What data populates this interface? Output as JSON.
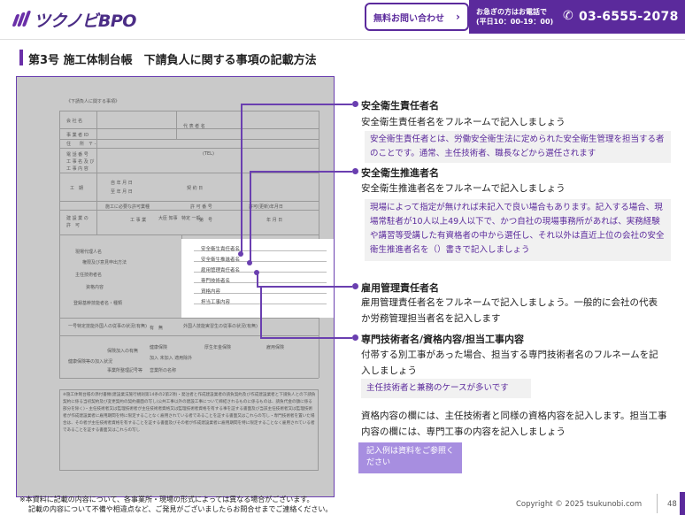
{
  "header": {
    "logo_text": "ツクノビBPO",
    "contact_button": "無料お問い合わせ",
    "phone_note_line1": "お急ぎの方はお電話で",
    "phone_note_line2": "(平日10：00-19：00)",
    "phone_number": "03-6555-2078"
  },
  "page_title": "第3号 施工体制台帳　下請負人に関する事項の記載方法",
  "form_image": {
    "caption": "《下請負人に関する事項》",
    "fields": [
      "会 社 名",
      "代 表 者 名",
      "事 業 者 ID",
      "住　　所　〒 -",
      "電 話 番 号",
      "(TEL)",
      "工 事 名 及 び",
      "工 事 内 容",
      "工　期",
      "自 年 月 日",
      "至 年 月 日",
      "契 約 日",
      "施工に必要な許可業種",
      "許 可 番 号",
      "許可(更新)年月日",
      "建 設 業 の",
      "許　可",
      "工 事 業",
      "大臣 知事",
      "特定 一般",
      "第　号",
      "年 月 日",
      "現場代理人名",
      "権限及び意見申出方法",
      "主任技術者名",
      "資格内容",
      "登録基幹技能者名・種類",
      "一号特定技能外国人の従事の状況(有無)",
      "有　無",
      "外国人技能実習生の従事の状況(有無)",
      "健康保険",
      "厚生年金保険",
      "雇用保険",
      "保険加入の有無",
      "加入 未加入 適用除外",
      "健康保険等の加入状況",
      "事業所整理記号等",
      "営業所の名称"
    ],
    "white_fields": [
      "安全衛生責任者名",
      "安全衛生推進者名",
      "雇用管理責任者名",
      "専門技術者名",
      "資格内容",
      "担当工事内容"
    ],
    "notes": "※施工体制台帳の添付書類(建設業法施行規則第14条の2第2項)・発注者と作成建設業者の請負契約及び作成建設業者と下請負人との下請負契約に係る当初契約及び変更契約の契約書面の写し(公共工事以外の建設工事について締結されるものに係るものは、請負代金の額に係る部分を除く)・主任技術者又は監理技術者が主任技術者資格又は監理技術者資格を有する事を証する書面及び当該主任技術者又は監理技術者が作成建設業者に雇用期間を特に限定することなく雇用されている者であることを証する書面又はこれらの写し・専門技術者を置いた場合は、その者が主任技術者資格を有することを証する書面及びその者が作成建設業者に雇用期間を特に限定することなく雇用されている者であることを証する書面又はこれらの写し"
  },
  "sections": [
    {
      "heading": "安全衛生責任者名",
      "body": "安全衛生責任者名をフルネームで記入しましょう",
      "note": "安全衛生責任者とは、労働安全衛生法に定められた安全衛生管理を担当する者のことです。通常、主任技術者、職長などから選任されます"
    },
    {
      "heading": "安全衛生推進者名",
      "body": "安全衛生推進者名をフルネームで記入しましょう",
      "note": "現場によって指定が無ければ未記入で良い場合もあります。記入する場合、現場常駐者が10人以上49人以下で、かつ自社の現場事務所があれば、実務経験や講習等受講した有資格者の中から選任し、それ以外は直近上位の会社の安全衛生推進者名を（）書きで記入しましょう"
    },
    {
      "heading": "雇用管理責任者名",
      "body": "雇用管理責任者名をフルネームで記入しましょう。一般的に会社の代表か労務管理担当者名を記入します"
    },
    {
      "heading": "専門技術者名/資格内容/担当工事内容",
      "body": "付帯する別工事があった場合、担当する専門技術者名のフルネームを記入しましょう",
      "note": "主任技術者と兼務のケースが多いです",
      "body2": "資格内容の欄には、主任技術者と同様の資格内容を記入します。担当工事内容の欄には、専門工事の内容を記入しましょう"
    }
  ],
  "reference_box": "記入例は資料をご参照ください",
  "footer": {
    "note_line1": "※本資料に記載の内容について、各事業所・現場の形式によっては異なる場合がございます。",
    "note_line2": "記載の内容について不備や相違点など、ご発見がございましたらお問合せまでご連絡ください。",
    "copyright": "Copyright © 2025 tsukunobi.com",
    "page_number": "48"
  },
  "colors": {
    "accent": "#5b2a9c",
    "connector": "#6a3fb0",
    "panel_bg": "#f1f1f1",
    "ref_box": "#a78ee0"
  }
}
